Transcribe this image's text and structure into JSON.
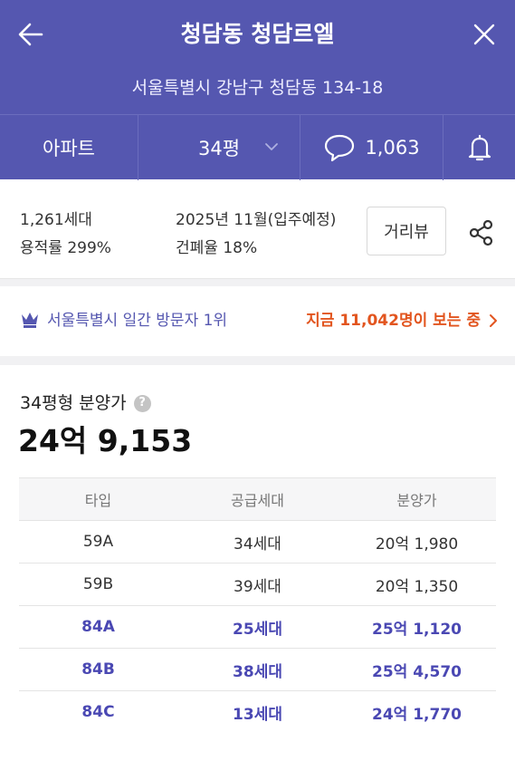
{
  "header": {
    "title": "청담동 청담르엘",
    "address": "서울특별시 강남구 청담동 134-18"
  },
  "subbar": {
    "property_type": "아파트",
    "size": "34평",
    "comment_count": "1,063"
  },
  "info": {
    "households": "1,261세대",
    "floor_area_ratio": "용적률 299%",
    "move_in": "2025년 11월(입주예정)",
    "coverage_ratio": "건폐율 18%",
    "street_view_button": "거리뷰"
  },
  "visitors": {
    "rank_text": "서울특별시 일간 방문자 1위",
    "live_text": "지금 11,042명이 보는 중"
  },
  "sale_price": {
    "label": "34평형 분양가",
    "value": "24억 9,153"
  },
  "price_table": {
    "headers": [
      "타입",
      "공급세대",
      "분양가"
    ],
    "rows": [
      {
        "type": "59A",
        "supply": "34세대",
        "price": "20억 1,980",
        "highlight": false
      },
      {
        "type": "59B",
        "supply": "39세대",
        "price": "20억 1,350",
        "highlight": false
      },
      {
        "type": "84A",
        "supply": "25세대",
        "price": "25억 1,120",
        "highlight": true
      },
      {
        "type": "84B",
        "supply": "38세대",
        "price": "25억 4,570",
        "highlight": true
      },
      {
        "type": "84C",
        "supply": "13세대",
        "price": "24억 1,770",
        "highlight": true
      }
    ]
  },
  "colors": {
    "brand": "#5557b0",
    "accent_orange": "#e2551f",
    "highlight_text": "#4a48b3"
  }
}
